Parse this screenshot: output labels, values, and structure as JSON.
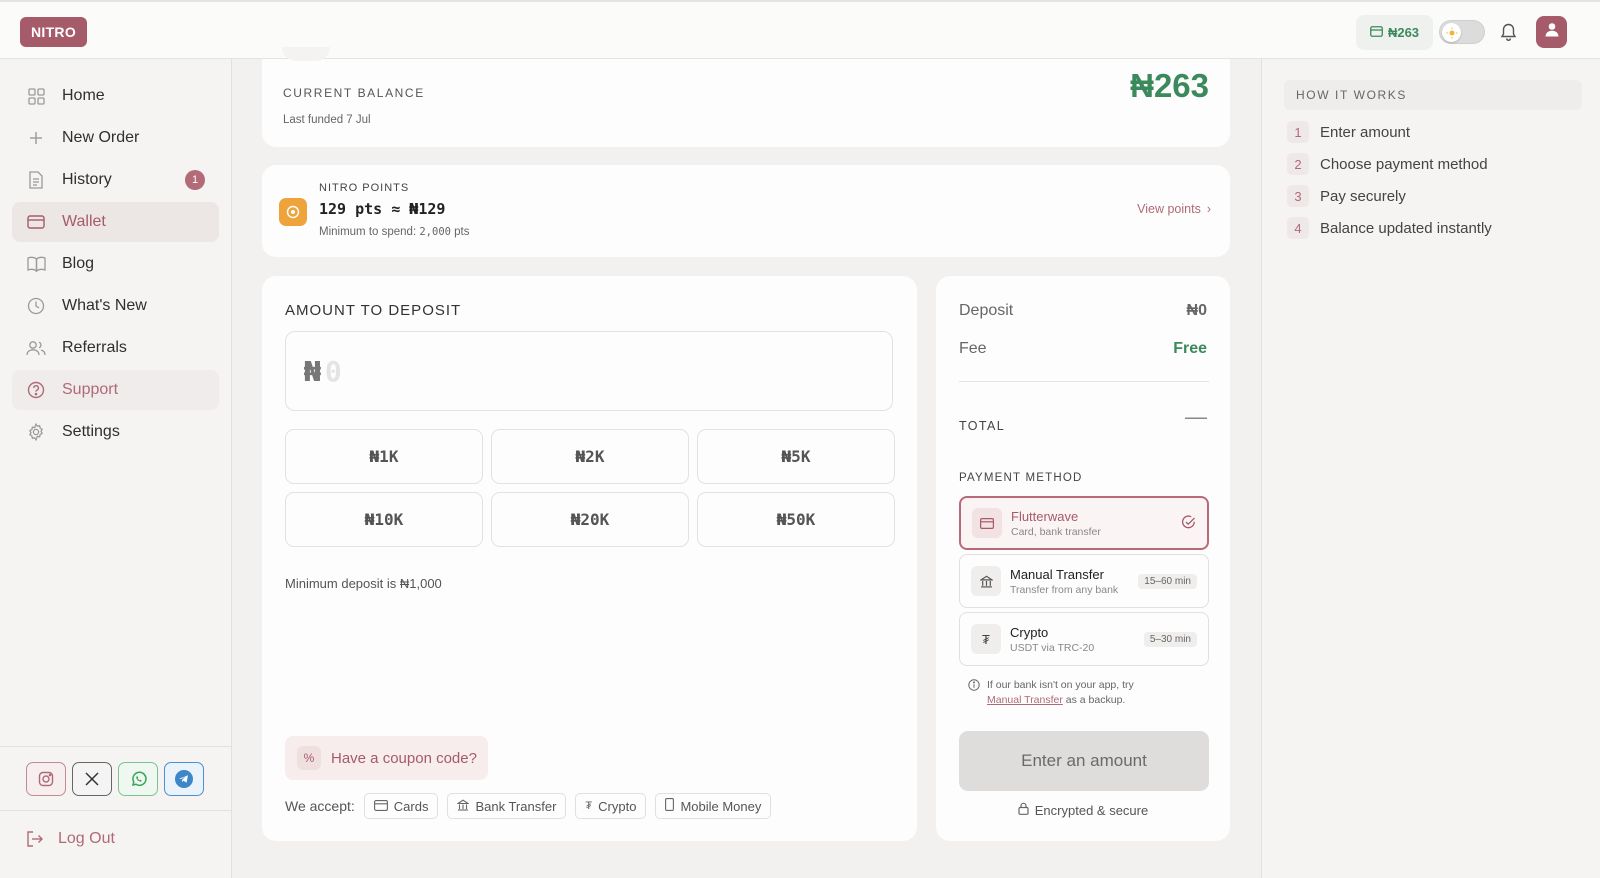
{
  "brand": {
    "logo_text": "NITRO",
    "accent": "#a65b6a",
    "green": "#3b8a5b"
  },
  "topbar": {
    "balance": "₦263",
    "wallet_icon": "wallet-icon",
    "theme_icon": "sun-icon",
    "bell_icon": "bell-icon",
    "avatar_icon": "user-icon"
  },
  "sidebar": {
    "items": [
      {
        "label": "Home",
        "icon": "grid-icon"
      },
      {
        "label": "New Order",
        "icon": "plus-icon"
      },
      {
        "label": "History",
        "icon": "document-icon",
        "badge": "1"
      },
      {
        "label": "Wallet",
        "icon": "wallet-icon"
      },
      {
        "label": "Blog",
        "icon": "book-icon"
      },
      {
        "label": "What's New",
        "icon": "clock-icon"
      },
      {
        "label": "Referrals",
        "icon": "users-icon"
      },
      {
        "label": "Support",
        "icon": "help-icon"
      },
      {
        "label": "Settings",
        "icon": "gear-icon"
      }
    ],
    "socials": [
      "instagram-icon",
      "x-icon",
      "whatsapp-icon",
      "telegram-icon"
    ],
    "logout_label": "Log Out"
  },
  "balance": {
    "eyebrow": "CURRENT BALANCE",
    "last_funded": "Last funded 7 Jul",
    "amount": "₦263"
  },
  "points": {
    "eyebrow": "NITRO POINTS",
    "value": "129 pts ≈ ₦129",
    "min_prefix": "Minimum to spend: ",
    "min_value": "2,000",
    "min_suffix": " pts",
    "link": "View points",
    "link_arrow": "›"
  },
  "deposit": {
    "title": "AMOUNT TO DEPOSIT",
    "currency": "₦",
    "placeholder": "0",
    "presets": [
      "₦1K",
      "₦2K",
      "₦5K",
      "₦10K",
      "₦20K",
      "₦50K"
    ],
    "min_note": "Minimum deposit is ₦1,000",
    "coupon_icon": "%",
    "coupon": "Have a coupon code?",
    "accept_label": "We accept:",
    "accept": [
      "Cards",
      "Bank Transfer",
      "Crypto",
      "Mobile Money"
    ]
  },
  "summary": {
    "deposit_label": "Deposit",
    "deposit_value": "₦0",
    "fee_label": "Fee",
    "fee_value": "Free",
    "total_label": "TOTAL",
    "total_value": "—",
    "payment_heading": "PAYMENT METHOD",
    "methods": [
      {
        "title": "Flutterwave",
        "sub": "Card, bank transfer",
        "selected": true
      },
      {
        "title": "Manual Transfer",
        "sub": "Transfer from any bank",
        "eta": "15–60 min"
      },
      {
        "title": "Crypto",
        "sub": "USDT via TRC-20",
        "eta": "5–30 min"
      }
    ],
    "note_prefix": "If our bank isn't on your app, try",
    "note_link": "Manual Transfer",
    "note_suffix": " as a backup.",
    "cta": "Enter an amount",
    "secure": "Encrypted & secure"
  },
  "how_it_works": {
    "title": "HOW IT WORKS",
    "steps": [
      {
        "num": "1",
        "text": "Enter amount"
      },
      {
        "num": "2",
        "text": "Choose payment method"
      },
      {
        "num": "3",
        "text": "Pay securely"
      },
      {
        "num": "4",
        "text": "Balance updated instantly"
      }
    ]
  }
}
